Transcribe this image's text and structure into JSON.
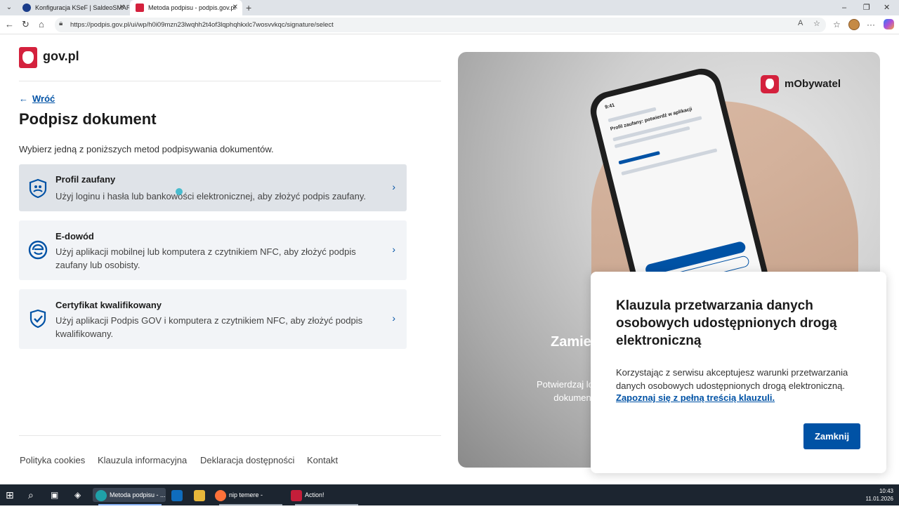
{
  "browser": {
    "tabs": [
      {
        "label": "Konfiguracja KSeF | SaldeoSMART",
        "color": "#1a3c8a"
      },
      {
        "label": "Metoda podpisu - podpis.gov.pl",
        "color": "#d4213d"
      }
    ],
    "url": "https://podpis.gov.pl/ui/wp/h0i09mzn23lwqhh2t4of3lqphqhkxlc7wosvvkqc/signature/select"
  },
  "site": {
    "logo_text": "gov.pl"
  },
  "main": {
    "back_label": "Wróć",
    "title": "Podpisz dokument",
    "intro": "Wybierz jedną z poniższych metod podpisywania dokumentów.",
    "methods": [
      {
        "title": "Profil zaufany",
        "description": "Użyj loginu i hasła lub bankowości elektronicznej, aby złożyć podpis zaufany.",
        "icon": "trusted-profile-icon"
      },
      {
        "title": "E-dowód",
        "description": "Użyj aplikacji mobilnej lub komputera z czytnikiem NFC, aby złożyć podpis zaufany lub osobisty.",
        "icon": "e-id-icon"
      },
      {
        "title": "Certyfikat kwalifikowany",
        "description": "Użyj aplikacji Podpis GOV i komputera z czytnikiem NFC, aby złożyć podpis kwalifikowany.",
        "icon": "qualified-certificate-icon"
      }
    ]
  },
  "footer": {
    "links": [
      "Polityka cookies",
      "Klauzula informacyjna",
      "Deklaracja dostępności",
      "Kontakt"
    ]
  },
  "hero": {
    "brand": "mObywatel",
    "heading_partial": "Zamie",
    "sub_lines": [
      "Potwierdzaj logowa",
      "dokumentów je"
    ],
    "phone_time": "9:41",
    "phone_title": "Profil zaufany: potwierdź w aplikacji"
  },
  "modal": {
    "title": "Klauzula przetwarzania danych osobowych udostępnionych drogą elektroniczną",
    "text": "Korzystając z serwisu akceptujesz warunki przetwarzania danych osobowych udostępnionych drogą elektroniczną.",
    "link": "Zapoznaj się z pełną treścią klauzuli.",
    "close_label": "Zamknij"
  },
  "taskbar": {
    "items": [
      {
        "label": "Metoda podpisu - ...",
        "icon": "edge-icon"
      },
      {
        "label": "nip temere - Szukaj...",
        "icon": "firefox-icon"
      },
      {
        "label": "Action!",
        "icon": "action-icon"
      }
    ],
    "time": "10:43",
    "date": "11.01.2026"
  },
  "colors": {
    "primary": "#0052a5",
    "gov_red": "#d4213d",
    "card_bg": "#f2f4f7"
  }
}
